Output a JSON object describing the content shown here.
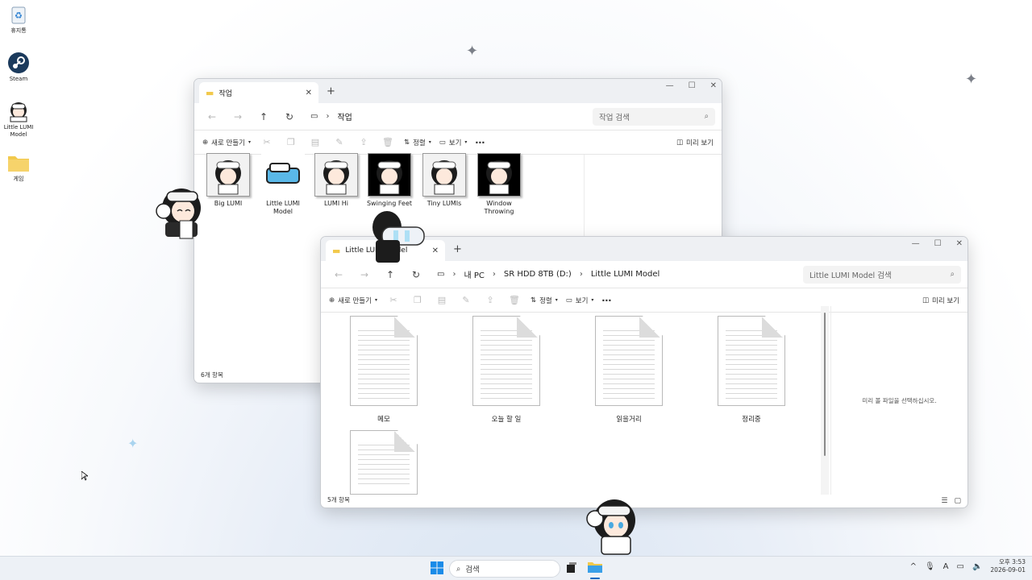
{
  "desktop": {
    "icons": [
      {
        "label": "휴지통",
        "icon": "recycle-bin-icon"
      },
      {
        "label": "Steam",
        "icon": "steam-icon"
      },
      {
        "label": "Little LUMI Model",
        "icon": "lumi-icon"
      },
      {
        "label": "게임",
        "icon": "folder-icon"
      }
    ]
  },
  "window1": {
    "tab_title": "작업",
    "breadcrumb": [
      "작업"
    ],
    "search_placeholder": "작업 검색",
    "toolbar": {
      "new": "새로 만들기",
      "sort": "정렬",
      "view": "보기",
      "preview": "미리 보기"
    },
    "items": [
      {
        "label": "Big LUMI",
        "style": "light"
      },
      {
        "label": "Little LUMI Model",
        "style": "logo"
      },
      {
        "label": "LUMI Hi",
        "style": "light"
      },
      {
        "label": "Swinging Feet",
        "style": "dark"
      },
      {
        "label": "Tiny LUMIs",
        "style": "light"
      },
      {
        "label": "Window Throwing",
        "style": "dark"
      }
    ],
    "status": "6개 항목"
  },
  "window2": {
    "tab_title": "Little LUMI Model",
    "breadcrumb": [
      "내 PC",
      "SR HDD 8TB (D:)",
      "Little LUMI Model"
    ],
    "search_placeholder": "Little LUMI Model 검색",
    "toolbar": {
      "new": "새로 만들기",
      "sort": "정렬",
      "view": "보기",
      "preview": "미리 보기"
    },
    "files": [
      "메모",
      "오늘 할 일",
      "읽을거리",
      "정리중",
      ""
    ],
    "preview_message": "미리 볼 파일을 선택하십시오.",
    "status": "5개 항목"
  },
  "taskbar": {
    "search_label": "검색",
    "clock_time": "오후 3:53",
    "clock_date": "2026-09-01",
    "ime": "A"
  },
  "colors": {
    "accent": "#0067c0",
    "folder": "#f2c94c",
    "desktop_bg": "#e8eef7"
  }
}
